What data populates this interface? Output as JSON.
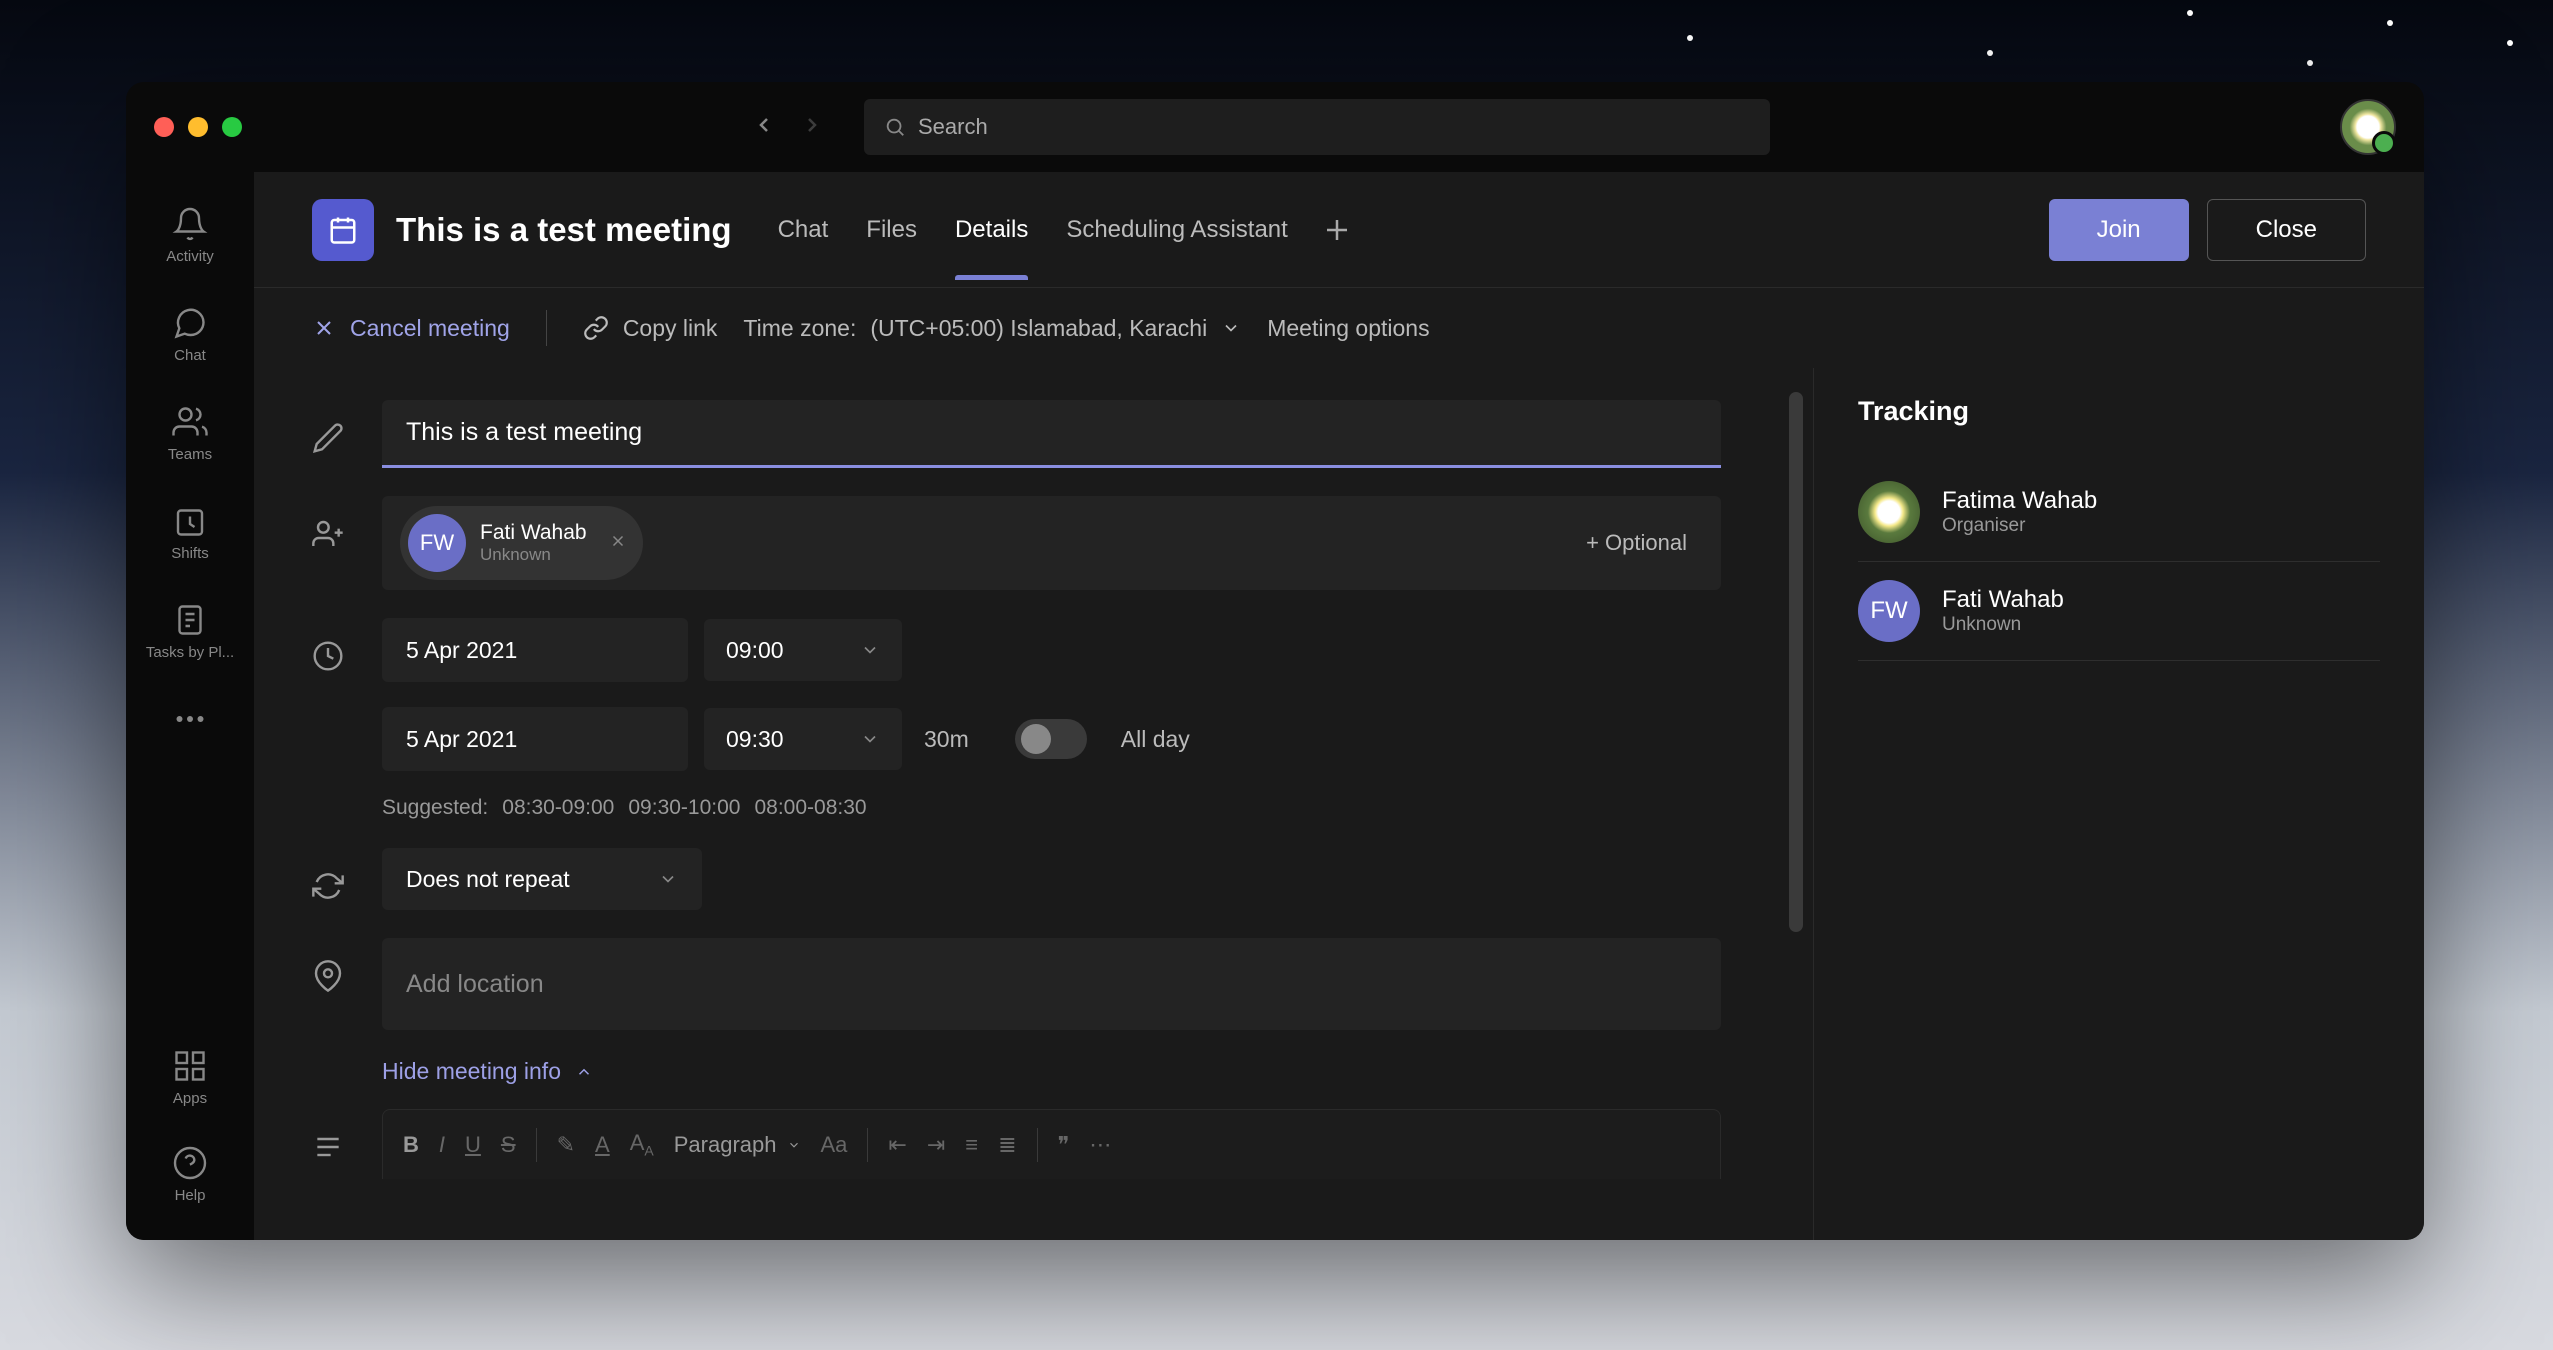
{
  "titlebar": {
    "search_placeholder": "Search"
  },
  "rail": {
    "items": [
      {
        "label": "Activity"
      },
      {
        "label": "Chat"
      },
      {
        "label": "Teams"
      },
      {
        "label": "Shifts"
      },
      {
        "label": "Tasks by Pl..."
      }
    ],
    "apps_label": "Apps",
    "help_label": "Help"
  },
  "header": {
    "title": "This is a test meeting",
    "tabs": [
      {
        "label": "Chat"
      },
      {
        "label": "Files"
      },
      {
        "label": "Details"
      },
      {
        "label": "Scheduling Assistant"
      }
    ],
    "join_label": "Join",
    "close_label": "Close"
  },
  "toolbar": {
    "cancel_label": "Cancel meeting",
    "copy_link_label": "Copy link",
    "timezone_label": "Time zone:",
    "timezone_value": "(UTC+05:00) Islamabad, Karachi",
    "meeting_options_label": "Meeting options"
  },
  "form": {
    "title_value": "This is a test meeting",
    "attendee": {
      "initials": "FW",
      "name": "Fati Wahab",
      "sub": "Unknown"
    },
    "optional_label": "+ Optional",
    "start_date": "5 Apr 2021",
    "start_time": "09:00",
    "end_date": "5 Apr 2021",
    "end_time": "09:30",
    "duration": "30m",
    "allday_label": "All day",
    "suggested_label": "Suggested:",
    "suggestions": [
      "08:30-09:00",
      "09:30-10:00",
      "08:00-08:30"
    ],
    "repeat_value": "Does not repeat",
    "location_placeholder": "Add location",
    "hide_info_label": "Hide meeting info",
    "paragraph_label": "Paragraph"
  },
  "tracking": {
    "heading": "Tracking",
    "people": [
      {
        "type": "daisy",
        "name": "Fatima Wahab",
        "sub": "Organiser"
      },
      {
        "type": "initials",
        "initials": "FW",
        "name": "Fati Wahab",
        "sub": "Unknown"
      }
    ]
  }
}
